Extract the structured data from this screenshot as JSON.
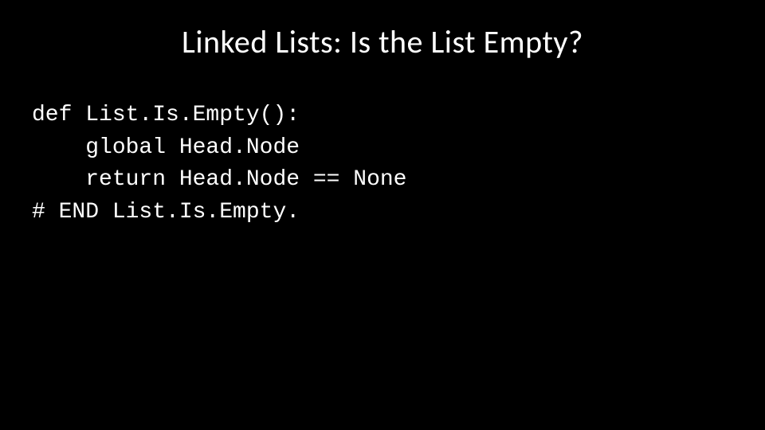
{
  "title": "Linked Lists: Is the List Empty?",
  "code": {
    "line1": "def List.Is.Empty():",
    "line2": "    global Head.Node",
    "line3": "    return Head.Node == None",
    "line4": "# END List.Is.Empty."
  }
}
